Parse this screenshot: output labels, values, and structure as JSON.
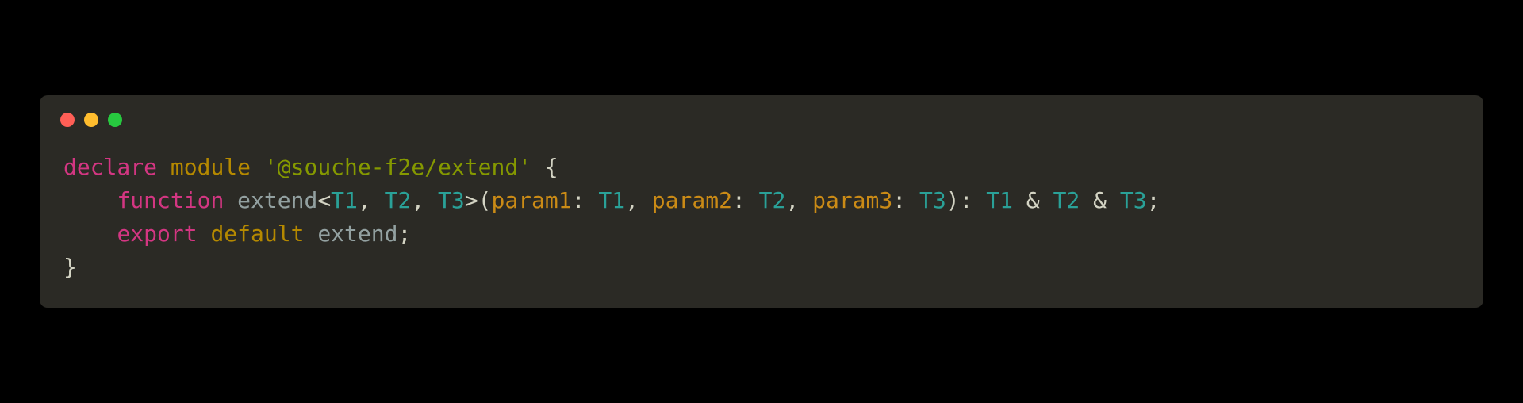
{
  "code": {
    "line1": {
      "declare": "declare",
      "module": "module",
      "moduleName": "'@souche-f2e/extend'",
      "openBrace": " {"
    },
    "line2": {
      "indent": "    ",
      "function": "function",
      "funcName": "extend",
      "lt": "<",
      "t1": "T1",
      "comma1": ", ",
      "t2": "T2",
      "comma2": ", ",
      "t3": "T3",
      "gt": ">",
      "openParen": "(",
      "param1": "param1",
      "colon1": ": ",
      "ptype1": "T1",
      "comma3": ", ",
      "param2": "param2",
      "colon2": ": ",
      "ptype2": "T2",
      "comma4": ", ",
      "param3": "param3",
      "colon3": ": ",
      "ptype3": "T3",
      "closeParen": ")",
      "colonRet": ": ",
      "rtype1": "T1",
      "amp1": " & ",
      "rtype2": "T2",
      "amp2": " & ",
      "rtype3": "T3",
      "semi": ";"
    },
    "line3": {
      "indent": "    ",
      "export": "export",
      "default": "default",
      "name": "extend",
      "semi": ";"
    },
    "line4": {
      "closeBrace": "}"
    }
  }
}
